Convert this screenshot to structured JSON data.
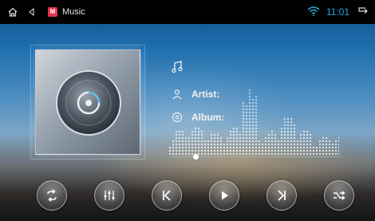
{
  "status_bar": {
    "app_name": "Music",
    "app_badge_letter": "M",
    "time": "11:01",
    "icons": [
      "home-icon",
      "back-icon",
      "wifi-icon",
      "return-icon"
    ]
  },
  "track": {
    "artist_label": "Artist:",
    "album_label": "Album:"
  },
  "playback": {
    "progress": 0.14
  },
  "controls": [
    {
      "name": "repeat-button",
      "icon": "repeat-icon"
    },
    {
      "name": "equalizer-button",
      "icon": "equalizer-icon"
    },
    {
      "name": "previous-button",
      "icon": "previous-icon"
    },
    {
      "name": "play-button",
      "icon": "play-icon"
    },
    {
      "name": "next-button",
      "icon": "next-icon"
    },
    {
      "name": "shuffle-button",
      "icon": "shuffle-icon"
    }
  ],
  "colors": {
    "accent": "#29a8e0",
    "app_badge": "#e8324a"
  }
}
